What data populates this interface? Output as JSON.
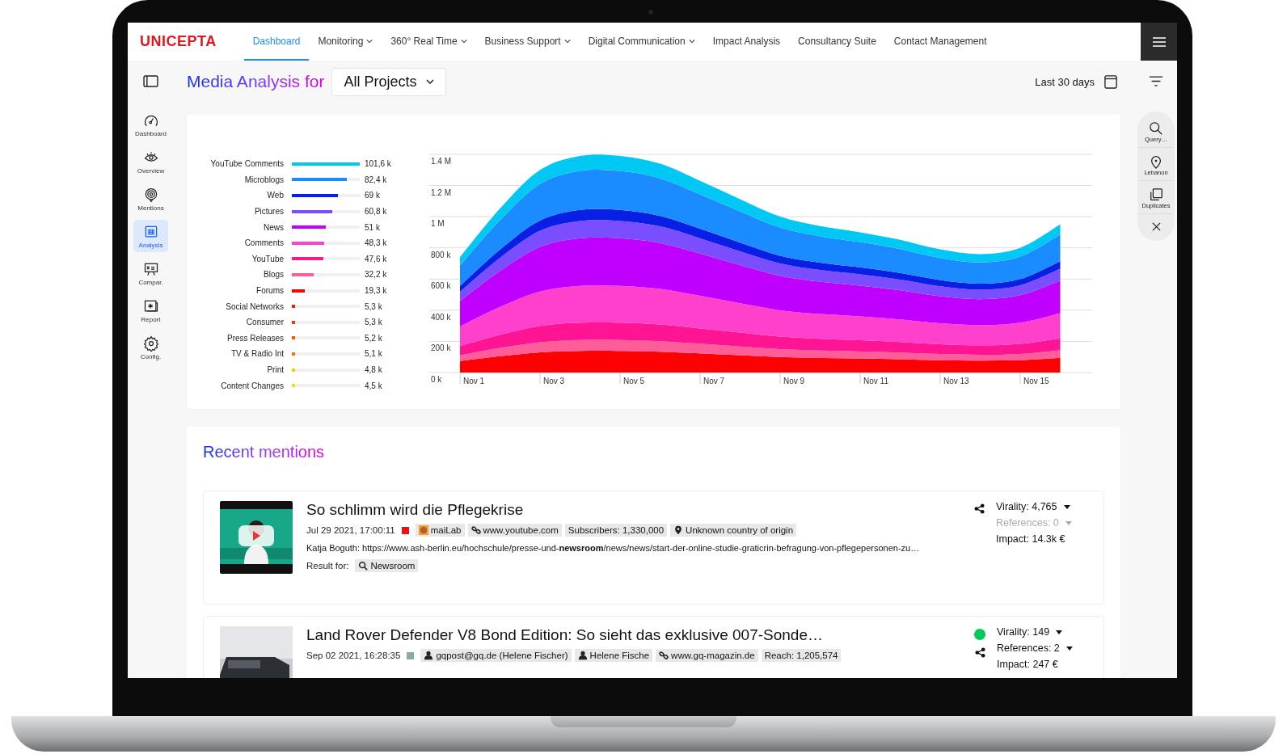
{
  "app": {
    "logo": "UNICEPTA"
  },
  "nav": [
    {
      "label": "Dashboard",
      "selected": true,
      "dropdown": false
    },
    {
      "label": "Monitoring",
      "selected": false,
      "dropdown": true
    },
    {
      "label": "360° Real Time",
      "selected": false,
      "dropdown": true
    },
    {
      "label": "Business Support",
      "selected": false,
      "dropdown": true
    },
    {
      "label": "Digital Communication",
      "selected": false,
      "dropdown": true
    },
    {
      "label": "Impact Analysis",
      "selected": false,
      "dropdown": false
    },
    {
      "label": "Consultancy Suite",
      "selected": false,
      "dropdown": false
    },
    {
      "label": "Contact Management",
      "selected": false,
      "dropdown": false
    }
  ],
  "header": {
    "title": "Media Analysis for",
    "project": "All Projects",
    "date_range": "Last 30 days"
  },
  "sidebar": [
    {
      "label": "Dashboard",
      "selected": false
    },
    {
      "label": "Overview",
      "selected": false
    },
    {
      "label": "Mentions",
      "selected": false
    },
    {
      "label": "Analysis",
      "selected": true
    },
    {
      "label": "Compar.",
      "selected": false
    },
    {
      "label": "Report",
      "selected": false
    },
    {
      "label": "Config.",
      "selected": false
    }
  ],
  "right_panel": [
    "Query…",
    "Lebanon",
    "Duplicates"
  ],
  "chart_card": {
    "sources": [
      {
        "label": "YouTube Comments",
        "value": "101,6 k",
        "level": 1.0,
        "color": "#00c8f5"
      },
      {
        "label": "Microblogs",
        "value": "82,4 k",
        "level": 0.811,
        "color": "#1a8cff"
      },
      {
        "label": "Web",
        "value": "69 k",
        "level": 0.679,
        "color": "#0a1fe6"
      },
      {
        "label": "Pictures",
        "value": "60,8 k",
        "level": 0.598,
        "color": "#7a4dff"
      },
      {
        "label": "News",
        "value": "51 k",
        "level": 0.502,
        "color": "#c000ff"
      },
      {
        "label": "Comments",
        "value": "48,3 k",
        "level": 0.475,
        "color": "#ff40cc"
      },
      {
        "label": "YouTube",
        "value": "47,6 k",
        "level": 0.469,
        "color": "#ff1493"
      },
      {
        "label": "Blogs",
        "value": "32,2 k",
        "level": 0.317,
        "color": "#ff5c9a"
      },
      {
        "label": "Forums",
        "value": "19,3 k",
        "level": 0.19,
        "color": "#ff0000"
      },
      {
        "label": "Social Networks",
        "value": "5,3 k",
        "level": 0.052,
        "color": "#ff1a00"
      },
      {
        "label": "Consumer",
        "value": "5,3 k",
        "level": 0.052,
        "color": "#ff3300"
      },
      {
        "label": "Press Releases",
        "value": "5,2 k",
        "level": 0.051,
        "color": "#ff5500"
      },
      {
        "label": "TV & Radio Int",
        "value": "5,1 k",
        "level": 0.05,
        "color": "#ff7700"
      },
      {
        "label": "Print",
        "value": "4,8 k",
        "level": 0.047,
        "color": "#ffcc00"
      },
      {
        "label": "Content Changes",
        "value": "4,5 k",
        "level": 0.044,
        "color": "#ffdd00"
      }
    ],
    "area_chart": {
      "chart_data": {
        "type": "area",
        "stacked": true,
        "grid": true,
        "categories": [
          "Nov 1",
          null,
          "Nov 3",
          null,
          "Nov 5",
          null,
          "Nov 7",
          null,
          "Nov 9",
          null,
          "Nov 11",
          null,
          "Nov 13",
          null,
          "Nov 15",
          null
        ],
        "ylim": [
          0,
          1400000
        ],
        "yticks": [
          {
            "value": 0,
            "label": "0 k"
          },
          {
            "value": 200000,
            "label": "200 k"
          },
          {
            "value": 400000,
            "label": "400 k"
          },
          {
            "value": 600000,
            "label": "600 k"
          },
          {
            "value": 800000,
            "label": "800 k"
          },
          {
            "value": 1000000,
            "label": "1 M"
          },
          {
            "value": 1200000,
            "label": "1.2 M"
          },
          {
            "value": 1400000,
            "label": "1.4 M"
          }
        ],
        "series": [
          {
            "color": "#ff0000",
            "values": [
              74000,
              105000,
              130000,
              139000,
              139000,
              134000,
              123000,
              111000,
              100000,
              94000,
              90000,
              85000,
              79000,
              76000,
              80000,
              95000
            ]
          },
          {
            "color": "#ff5c9a",
            "values": [
              37000,
              53000,
              65000,
              70000,
              70000,
              67000,
              62000,
              56000,
              50000,
              47000,
              45000,
              43000,
              40000,
              38000,
              40000,
              48000
            ]
          },
          {
            "color": "#ff1493",
            "values": [
              59000,
              84000,
              104000,
              111000,
              111000,
              107000,
              98000,
              89000,
              80000,
              75000,
              72000,
              68000,
              63000,
              61000,
              64000,
              76000
            ]
          },
          {
            "color": "#ff40cc",
            "values": [
              126000,
              179000,
              221000,
              236000,
              236000,
              228000,
              209000,
              189000,
              170000,
              160000,
              153000,
              145000,
              134000,
              129000,
              136000,
              162000
            ]
          },
          {
            "color": "#c000ff",
            "values": [
              163000,
              231000,
              286000,
              306000,
              306000,
              295000,
              271000,
              244000,
              220000,
              207000,
              198000,
              187000,
              174000,
              167000,
              176000,
              209000
            ]
          },
          {
            "color": "#7a4dff",
            "values": [
              59000,
              84000,
              104000,
              111000,
              111000,
              107000,
              98000,
              89000,
              80000,
              75000,
              72000,
              68000,
              63000,
              61000,
              64000,
              76000
            ]
          },
          {
            "color": "#0a1fe6",
            "values": [
              37000,
              53000,
              65000,
              70000,
              70000,
              67000,
              62000,
              56000,
              50000,
              47000,
              45000,
              43000,
              40000,
              38000,
              40000,
              48000
            ]
          },
          {
            "color": "#1a8cff",
            "values": [
              133000,
              189000,
              234000,
              250000,
              250000,
              241000,
              221000,
              200000,
              180000,
              169000,
              162000,
              153000,
              142000,
              137000,
              144000,
              171000
            ]
          },
          {
            "color": "#00c8f5",
            "values": [
              52000,
              74000,
              91000,
              97000,
              97000,
              94000,
              86000,
              78000,
              70000,
              66000,
              63000,
              60000,
              55000,
              53000,
              56000,
              67000
            ]
          }
        ]
      }
    }
  },
  "recent_mentions": {
    "title": "Recent mentions",
    "items": [
      {
        "thumbnail": {
          "kind": "picture"
        },
        "title": "So schlimm wird die Pflegekrise",
        "date": "Jul 29 2021, 17:00:11",
        "source_marker": {
          "color": "#ee1111"
        },
        "tags": [
          {
            "kind": "avatar",
            "text": "maiLab"
          },
          {
            "kind": "link",
            "text": "www.youtube.com"
          },
          {
            "kind": "plain",
            "text": "Subscribers: 1,330,000"
          },
          {
            "kind": "location",
            "text": "Unknown country of origin"
          }
        ],
        "snippet": "Katja Boguth: https://www.ash-berlin.eu/hochschule/presse-und-**newsroom**/news/news/start-der-online-studie-graticrin-befragung-von-pflegepersonen-zu…",
        "result_for": {
          "label": "Result for:",
          "query": "Newsroom"
        },
        "stats": [
          {
            "text": "Virality: 4,765",
            "disabled": false,
            "dropdown": true
          },
          {
            "text": "References: 0",
            "disabled": true,
            "dropdown": true
          },
          {
            "text": "Impact: 14.3k €",
            "disabled": false,
            "dropdown": false
          }
        ]
      },
      {
        "thumbnail": {
          "kind": "picture"
        },
        "title": "Land Rover Defender V8 Bond Edition: So sieht das exklusive 007-Sonde…",
        "date": "Sep 02 2021, 16:28:35",
        "source_marker": {
          "color": "#88aaaa"
        },
        "sentiment_dot": {
          "color": "#00cc55"
        },
        "tags": [
          {
            "kind": "user",
            "text": "gqpost@gq.de (Helene Fischer)"
          },
          {
            "kind": "user",
            "text": "Helene Fische"
          },
          {
            "kind": "link",
            "text": "www.gq-magazin.de"
          },
          {
            "kind": "plain",
            "text": "Reach: 1,205,574"
          }
        ],
        "stats": [
          {
            "text": "Virality: 149",
            "disabled": false,
            "dropdown": true
          },
          {
            "text": "References: 2",
            "disabled": false,
            "dropdown": true
          },
          {
            "text": "Impact: 247 €",
            "disabled": false,
            "dropdown": false
          }
        ]
      }
    ]
  }
}
